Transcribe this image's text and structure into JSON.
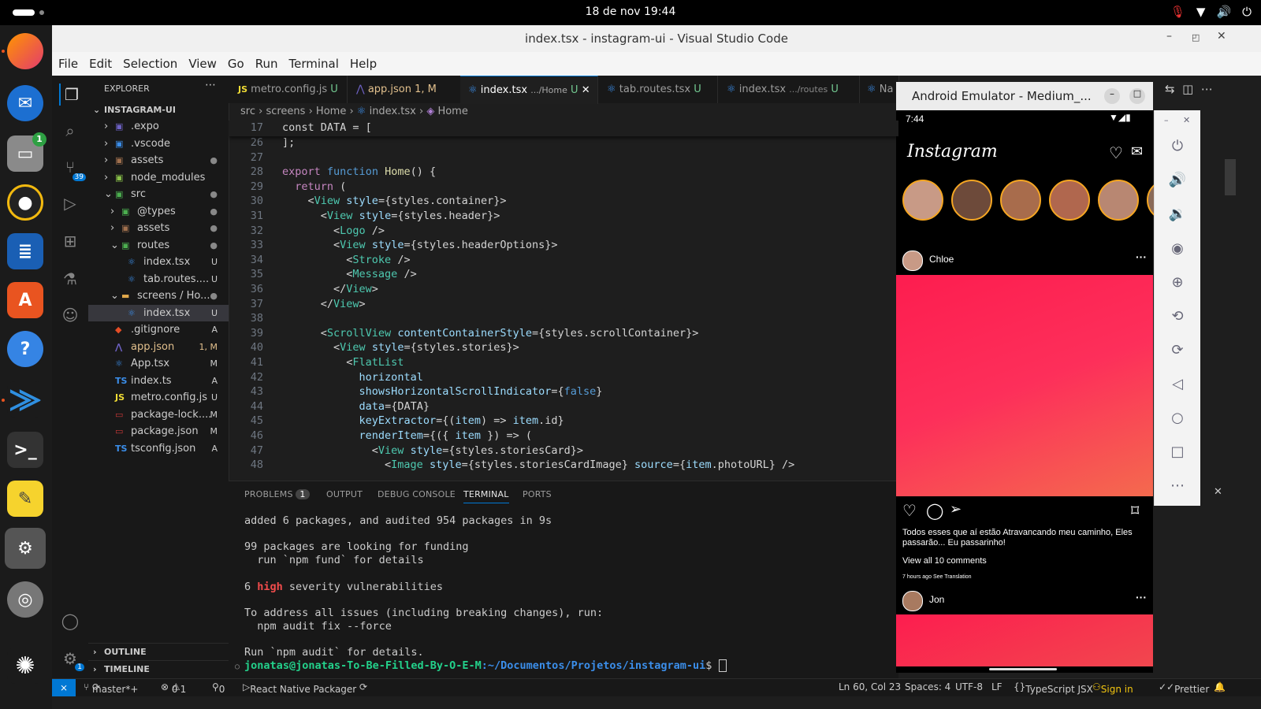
{
  "system": {
    "clock": "18 de nov  19:44"
  },
  "window": {
    "title": "index.tsx - instagram-ui - Visual Studio Code"
  },
  "menu": [
    "File",
    "Edit",
    "Selection",
    "View",
    "Go",
    "Run",
    "Terminal",
    "Help"
  ],
  "activity": {
    "scm_badge": "39",
    "settings_badge": "1"
  },
  "explorer": {
    "header": "EXPLORER",
    "root": "INSTAGRAM-UI",
    "items": [
      {
        "label": ".expo",
        "status": ""
      },
      {
        "label": ".vscode",
        "status": ""
      },
      {
        "label": "assets",
        "status": "●"
      },
      {
        "label": "node_modules",
        "status": ""
      },
      {
        "label": "src",
        "status": "●"
      },
      {
        "label": "@types",
        "status": "●"
      },
      {
        "label": "assets",
        "status": "●"
      },
      {
        "label": "routes",
        "status": "●"
      },
      {
        "label": "index.tsx",
        "status": "U"
      },
      {
        "label": "tab.routes....",
        "status": "U"
      },
      {
        "label": "screens / Ho...",
        "status": "●"
      },
      {
        "label": "index.tsx",
        "status": "U"
      },
      {
        "label": ".gitignore",
        "status": "A"
      },
      {
        "label": "app.json",
        "status": "1, M"
      },
      {
        "label": "App.tsx",
        "status": "M"
      },
      {
        "label": "index.ts",
        "status": "A"
      },
      {
        "label": "metro.config.js",
        "status": "U"
      },
      {
        "label": "package-lock....",
        "status": "M"
      },
      {
        "label": "package.json",
        "status": "M"
      },
      {
        "label": "tsconfig.json",
        "status": "A"
      }
    ],
    "outline": "OUTLINE",
    "timeline": "TIMELINE"
  },
  "tabs": [
    {
      "label": "metro.config.js",
      "status": "U"
    },
    {
      "label": "app.json",
      "status": "1, M"
    },
    {
      "label": "index.tsx",
      "path": ".../Home",
      "status": "U"
    },
    {
      "label": "tab.routes.tsx",
      "status": "U"
    },
    {
      "label": "index.tsx",
      "path": ".../routes",
      "status": "U"
    },
    {
      "label": "Na",
      "status": ""
    }
  ],
  "breadcrumb": [
    "src",
    "screens",
    "Home",
    "index.tsx",
    "Home"
  ],
  "code": [
    {
      "n": "17",
      "t": "const DATA = ["
    },
    {
      "n": "26",
      "t": "];"
    },
    {
      "n": "27",
      "t": ""
    },
    {
      "n": "28",
      "t": "export function Home() {"
    },
    {
      "n": "29",
      "t": "  return ("
    },
    {
      "n": "30",
      "t": "    <View style={styles.container}>"
    },
    {
      "n": "31",
      "t": "      <View style={styles.header}>"
    },
    {
      "n": "32",
      "t": "        <Logo />"
    },
    {
      "n": "33",
      "t": "        <View style={styles.headerOptions}>"
    },
    {
      "n": "34",
      "t": "          <Stroke />"
    },
    {
      "n": "35",
      "t": "          <Message />"
    },
    {
      "n": "36",
      "t": "        </View>"
    },
    {
      "n": "37",
      "t": "      </View>"
    },
    {
      "n": "38",
      "t": ""
    },
    {
      "n": "39",
      "t": "      <ScrollView contentContainerStyle={styles.scrollContainer}>"
    },
    {
      "n": "40",
      "t": "        <View style={styles.stories}>"
    },
    {
      "n": "41",
      "t": "          <FlatList"
    },
    {
      "n": "42",
      "t": "            horizontal"
    },
    {
      "n": "43",
      "t": "            showsHorizontalScrollIndicator={false}"
    },
    {
      "n": "44",
      "t": "            data={DATA}"
    },
    {
      "n": "45",
      "t": "            keyExtractor={(item) => item.id}"
    },
    {
      "n": "46",
      "t": "            renderItem={({ item }) => ("
    },
    {
      "n": "47",
      "t": "              <View style={styles.storiesCard}>"
    },
    {
      "n": "48",
      "t": "                <Image style={styles.storiesCardImage} source={item.photoURL} />"
    }
  ],
  "panel": {
    "tabs": [
      "PROBLEMS",
      "OUTPUT",
      "DEBUG CONSOLE",
      "TERMINAL",
      "PORTS"
    ],
    "problems_count": "1",
    "terminal": [
      "added 6 packages, and audited 954 packages in 9s",
      "",
      "99 packages are looking for funding",
      "  run `npm fund` for details",
      "",
      "6 high severity vulnerabilities",
      "",
      "To address all issues (including breaking changes), run:",
      "  npm audit fix --force",
      "",
      "Run `npm audit` for details."
    ],
    "prompt_user": "jonatas@jonatas-To-Be-Filled-By-O-E-M",
    "prompt_path": ":~/Documentos/Projetos/instagram-ui",
    "prompt_end": "$"
  },
  "status": {
    "branch": "master*+",
    "errors": "0",
    "warnings": "1",
    "ports": "0",
    "packager": "React Native Packager",
    "position": "Ln 60, Col 23",
    "spaces": "Spaces: 4",
    "encoding": "UTF-8",
    "eol": "LF",
    "language": "TypeScript JSX",
    "signin": "Sign in",
    "prettier": "Prettier"
  },
  "emulator": {
    "title": "Android Emulator - Medium_...",
    "time": "7:44",
    "app_name": "Instagram",
    "post1_user": "Chloe",
    "caption": "Todos esses que aí estão Atravancando meu caminho, Eles passarão... Eu passarinho!",
    "comments": "View all 10 comments",
    "time_ago": "7 hours ago",
    "see_translation": "See Translation",
    "post2_user": "Jon",
    "accent": "#fd1d4f"
  }
}
